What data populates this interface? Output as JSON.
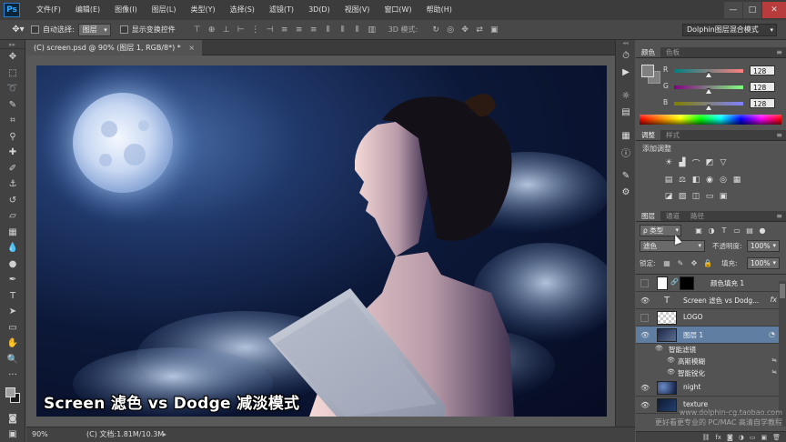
{
  "app": {
    "logo": "Ps",
    "menu": [
      "文件(F)",
      "编辑(E)",
      "图像(I)",
      "图层(L)",
      "类型(Y)",
      "选择(S)",
      "滤镜(T)",
      "3D(D)",
      "视图(V)",
      "窗口(W)",
      "帮助(H)"
    ],
    "window_controls": {
      "minimize": "—",
      "maximize": "□",
      "close": "✕"
    }
  },
  "options": {
    "auto_select_label": "自动选择:",
    "auto_select_value": "图层",
    "show_transform_label": "显示变换控件",
    "mode_3d_label": "3D 模式:",
    "workspace": "Dolphin图层混合模式"
  },
  "document": {
    "tab_label": "(C) screen.psd @ 90% (图层 1, RGB/8*) *",
    "close": "×",
    "caption": "Screen 滤色 vs Dodge 减淡模式"
  },
  "status": {
    "zoom": "90%",
    "doc_info": "(C) 文档:1.81M/10.3M",
    "arrow": "▸"
  },
  "color_panel": {
    "tabs": [
      "颜色",
      "色板"
    ],
    "channels": [
      {
        "label": "R",
        "value": "128"
      },
      {
        "label": "G",
        "value": "128"
      },
      {
        "label": "B",
        "value": "128"
      }
    ]
  },
  "adjustments_panel": {
    "tabs": [
      "调整",
      "样式"
    ],
    "title": "添加调整"
  },
  "layers_panel": {
    "tabs": [
      "图层",
      "通道",
      "路径"
    ],
    "kind": "ρ 类型",
    "blend_mode": "滤色",
    "opacity_label": "不透明度:",
    "opacity_value": "100%",
    "lock_label": "锁定:",
    "fill_label": "填充:",
    "fill_value": "100%",
    "layers": [
      {
        "name": "颜色填充 1",
        "visible": false
      },
      {
        "name": "Screen 滤色 vs Dodg...",
        "visible": true,
        "fx": "fx"
      },
      {
        "name": "LOGO",
        "visible": false
      },
      {
        "name": "图层 1",
        "visible": true,
        "selected": true
      },
      {
        "name": "night",
        "visible": true
      },
      {
        "name": "texture",
        "visible": true
      }
    ],
    "smart_filters_label": "智能滤镜",
    "filters": [
      "高斯模糊",
      "智能锐化"
    ]
  },
  "watermark": {
    "line1": "www.dolphin-cg.taobao.com",
    "line2": "更好看更专业的 PC/MAC 高清自学教程"
  },
  "colors": {
    "menubar": "#3c3c3c",
    "panel": "#535353",
    "selected_layer": "#5f7ea2",
    "accent": "#31a8ff"
  }
}
